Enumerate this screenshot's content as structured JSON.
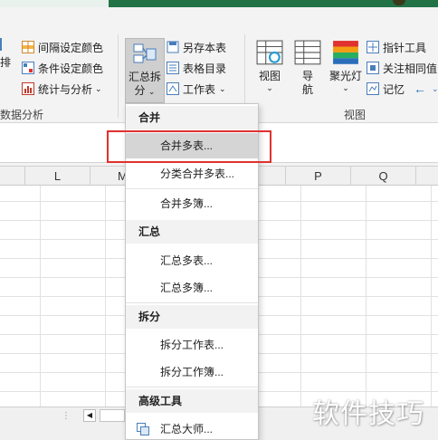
{
  "ribbon": {
    "left_partial_label": "排",
    "left_group_label": "数据分析",
    "col2": [
      "间隔设定颜色",
      "条件设定颜色",
      "统计与分析"
    ],
    "summarize_split": {
      "line1": "汇总拆",
      "line2": "分"
    },
    "col4": [
      "另存本表",
      "表格目录",
      "工作表"
    ],
    "view_buttons": {
      "view": "视图",
      "navigate": "导航",
      "spotlight": "聚光灯"
    },
    "col6": [
      "指针工具",
      "关注相同值",
      "记忆"
    ],
    "group_label": "视图"
  },
  "grid": {
    "columns": [
      "L",
      "M",
      "O",
      "P",
      "Q"
    ]
  },
  "menu": {
    "sections": [
      {
        "header": "合并",
        "items": [
          "合并多表...",
          "分类合并多表...",
          "合并多簿..."
        ]
      },
      {
        "header": "汇总",
        "items": [
          "汇总多表...",
          "汇总多簿..."
        ]
      },
      {
        "header": "拆分",
        "items": [
          "拆分工作表...",
          "拆分工作簿..."
        ]
      },
      {
        "header": "高级工具",
        "items": [
          "汇总大师..."
        ]
      }
    ]
  },
  "watermark": "软件技巧",
  "colors": {
    "accent_green": "#217346",
    "highlight_box": "#e0312f"
  }
}
